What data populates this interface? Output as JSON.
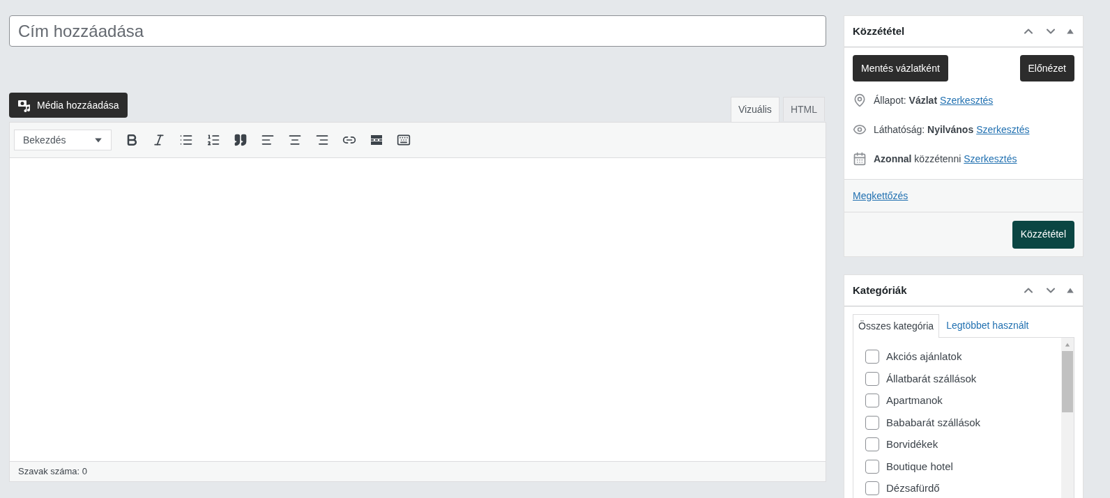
{
  "title_field": {
    "placeholder": "Cím hozzáadása"
  },
  "media_button": "Média hozzáadása",
  "editor_tabs": [
    {
      "label": "Vizuális",
      "selected": true
    },
    {
      "label": "HTML",
      "selected": false
    }
  ],
  "toolbar": {
    "format_select": "Bekezdés",
    "tools": [
      {
        "kind": "bold"
      },
      {
        "kind": "italic"
      },
      {
        "kind": "bullets"
      },
      {
        "kind": "numbers"
      },
      {
        "kind": "quote"
      },
      {
        "kind": "align-left"
      },
      {
        "kind": "align-center"
      },
      {
        "kind": "align-right"
      },
      {
        "kind": "link"
      },
      {
        "kind": "more"
      },
      {
        "kind": "keyboard"
      }
    ]
  },
  "status_bar": "Szavak száma: 0",
  "publish_box": {
    "title": "Közzététel",
    "save_draft": "Mentés vázlatként",
    "preview": "Előnézet",
    "rows": [
      {
        "kind": "status",
        "text": "Állapot: **Vázlat**",
        "link": "Szerkesztés"
      },
      {
        "kind": "visibility",
        "text": "Láthatóság: **Nyilvános**",
        "link": "Szerkesztés"
      },
      {
        "kind": "schedule",
        "text": "**Azonnal** közzétenni",
        "link": "Szerkesztés"
      }
    ],
    "duplicate_link": "Megkettőzés",
    "publish": "Közzététel"
  },
  "categories_box": {
    "title": "Kategóriák",
    "tabs": [
      {
        "label": "Összes kategória",
        "selected": true
      },
      {
        "label": "Legtöbbet használt",
        "selected": false
      }
    ],
    "items": [
      {
        "label": "Akciós ajánlatok",
        "checked": false
      },
      {
        "label": "Állatbarát szállások",
        "checked": false
      },
      {
        "label": "Apartmanok",
        "checked": false
      },
      {
        "label": "Bababarát szállások",
        "checked": false
      },
      {
        "label": "Borvidékek",
        "checked": false
      },
      {
        "label": "Boutique hotel",
        "checked": false
      },
      {
        "label": "Dézsafürdő",
        "checked": false
      }
    ]
  }
}
